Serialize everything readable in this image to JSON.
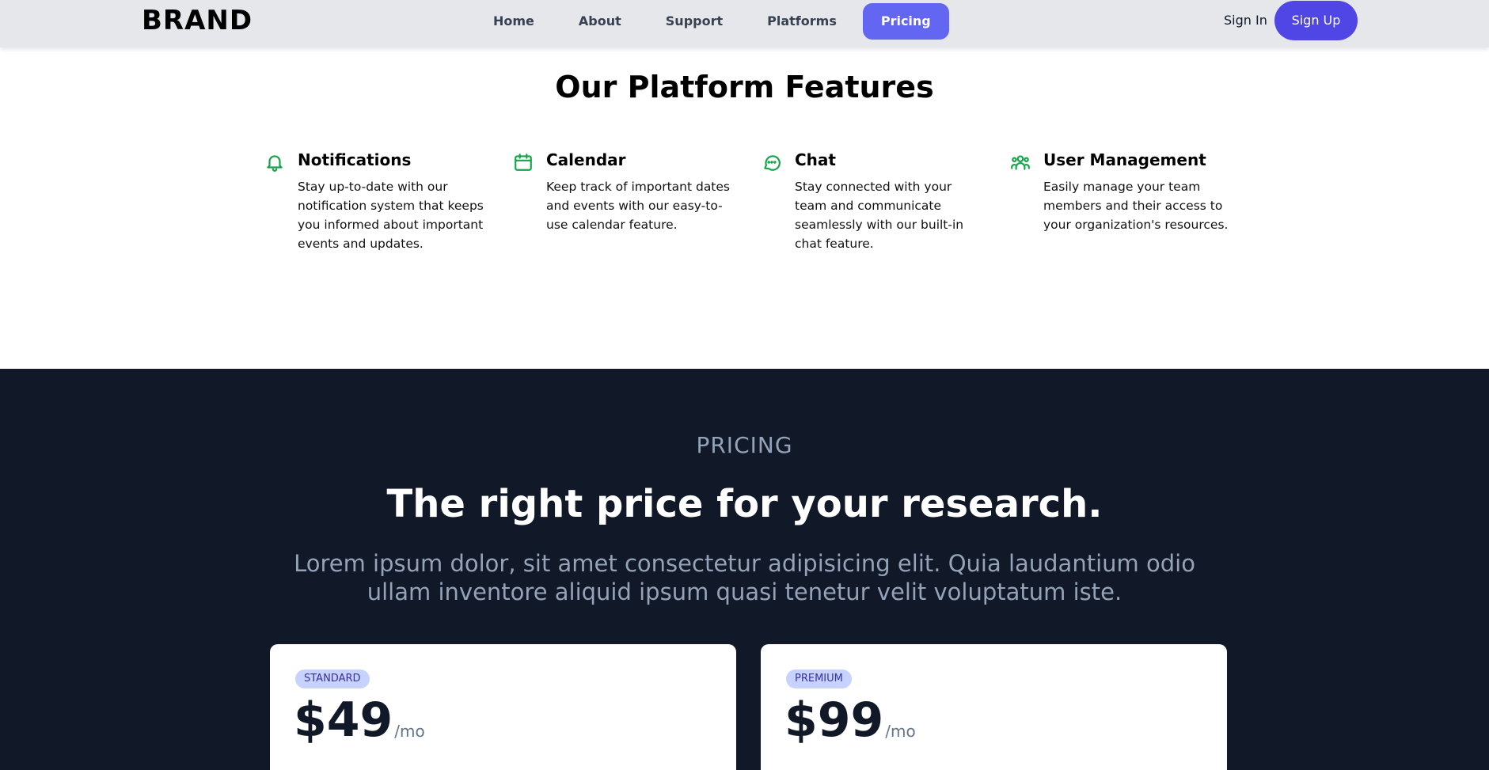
{
  "header": {
    "brand": "BRAND",
    "nav": [
      {
        "label": "Home"
      },
      {
        "label": "About"
      },
      {
        "label": "Support"
      },
      {
        "label": "Platforms"
      },
      {
        "label": "Pricing"
      }
    ],
    "active_nav": "Pricing",
    "sign_in": "Sign In",
    "sign_up": "Sign Up"
  },
  "features": {
    "title": "Our Platform Features",
    "items": [
      {
        "icon": "bell-icon",
        "title": "Notifications",
        "text": "Stay up-to-date with our notification system that keeps you informed about important events and updates."
      },
      {
        "icon": "calendar-icon",
        "title": "Calendar",
        "text": "Keep track of important dates and events with our easy-to-use calendar feature."
      },
      {
        "icon": "chat-icon",
        "title": "Chat",
        "text": "Stay connected with your team and communicate seamlessly with our built-in chat feature."
      },
      {
        "icon": "users-icon",
        "title": "User Management",
        "text": "Easily manage your team members and their access to your organization's resources."
      }
    ]
  },
  "pricing": {
    "eyebrow": "PRICING",
    "headline": "The right price for your research.",
    "subtext": "Lorem ipsum dolor, sit amet consectetur adipisicing elit. Quia laudantium odio ullam inventore aliquid ipsum quasi tenetur velit voluptatum iste.",
    "plans": [
      {
        "badge": "STANDARD",
        "price": "$49",
        "period": "/mo"
      },
      {
        "badge": "PREMIUM",
        "price": "$99",
        "period": "/mo"
      }
    ]
  },
  "colors": {
    "accent": "#6366f1",
    "signup": "#4f46e5",
    "icon_green": "#16a34a",
    "dark_bg": "#111827",
    "muted_text": "#94a3b8"
  }
}
